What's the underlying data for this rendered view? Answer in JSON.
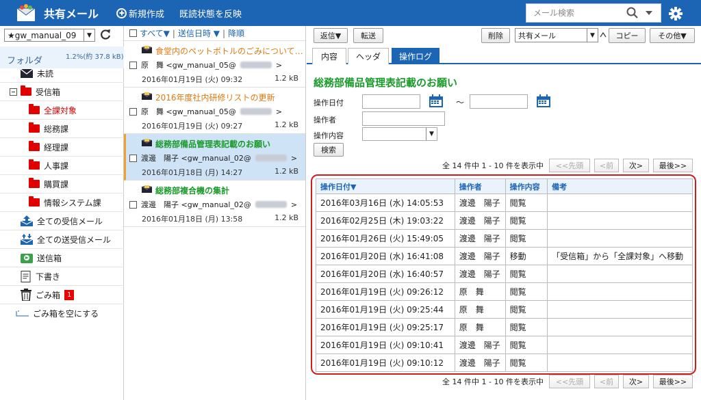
{
  "header": {
    "app_title": "共有メール",
    "new_label": "新規作成",
    "reflect_label": "既読状態を反映",
    "search_placeholder": "メール検索"
  },
  "left": {
    "account": "★gw_manual_09",
    "folder_title": "フォルダ",
    "quota": "1.2%(約 37.8 kB)",
    "folders": [
      {
        "label": "未読",
        "icon": "envelope-icon"
      },
      {
        "label": "受信箱",
        "icon": "folder-icon"
      },
      {
        "label": "全課対象",
        "icon": "folder-icon"
      },
      {
        "label": "総務課",
        "icon": "folder-icon"
      },
      {
        "label": "経理課",
        "icon": "folder-icon"
      },
      {
        "label": "人事課",
        "icon": "folder-icon"
      },
      {
        "label": "購買課",
        "icon": "folder-icon"
      },
      {
        "label": "情報システム課",
        "icon": "folder-icon"
      },
      {
        "label": "全ての受信メール",
        "icon": "inbox-all-icon"
      },
      {
        "label": "全ての送受信メール",
        "icon": "inbox-all-icon"
      },
      {
        "label": "送信箱",
        "icon": "outbox-icon"
      },
      {
        "label": "下書き",
        "icon": "draft-icon"
      },
      {
        "label": "ごみ箱",
        "icon": "trash-icon",
        "badge": "1"
      },
      {
        "label": "ごみ箱を空にする",
        "icon": "empty-trash-icon"
      }
    ]
  },
  "list": {
    "all_label": "すべて▼",
    "sort_label": "送信日時 ▼",
    "order_label": "降順",
    "messages": [
      {
        "subject": "食堂内のペットボトルのごみについて…",
        "from": "原　舞 <gw_manual_05@",
        "date": "2016年01月19日 (火) 09:32",
        "size": "1.2 kB"
      },
      {
        "subject": "2016年度社内研修リストの更新",
        "from": "原　舞 <gw_manual_05@",
        "date": "2016年01月19日 (火) 09:27",
        "size": "1.2 kB"
      },
      {
        "subject": "総務部備品管理表記載のお願い",
        "from": "渡邊　陽子 <gw_manual_02@",
        "date": "2016年01月18日 (月) 14:27",
        "size": "1.2 kB"
      },
      {
        "subject": "総務部複合機の集計",
        "from": "渡邊　陽子 <gw_manual_02@",
        "date": "2016年01月18日 (月) 13:58",
        "size": "1.2 kB"
      }
    ]
  },
  "toolbar": {
    "reply": "返信▼",
    "forward": "転送",
    "delete": "削除",
    "folder_value": "共有メール",
    "copy": "コピー",
    "more": "その他▼"
  },
  "tabs": [
    "内容",
    "ヘッダ",
    "操作ログ"
  ],
  "form": {
    "title": "総務部備品管理表記載のお願い",
    "date_label": "操作日付",
    "tilde": "～",
    "operator_label": "操作者",
    "action_label": "操作内容",
    "search_btn": "検索"
  },
  "pager": {
    "summary": "全 14 件中 1 - 10 件を表示中",
    "first": "<<先頭",
    "prev": "<前",
    "next": "次>",
    "last": "最後>>"
  },
  "log": {
    "headers": [
      "操作日付▼",
      "操作者",
      "操作内容",
      "備考"
    ],
    "rows": [
      [
        "2016年03月16日 (水) 14:05:53",
        "渡邊　陽子",
        "閲覧",
        ""
      ],
      [
        "2016年02月25日 (木) 19:03:22",
        "渡邊　陽子",
        "閲覧",
        ""
      ],
      [
        "2016年01月26日 (火) 15:49:05",
        "渡邊　陽子",
        "閲覧",
        ""
      ],
      [
        "2016年01月20日 (水) 16:41:08",
        "渡邊　陽子",
        "移動",
        "「受信箱」から「全課対象」へ移動"
      ],
      [
        "2016年01月20日 (水) 16:40:57",
        "渡邊　陽子",
        "閲覧",
        ""
      ],
      [
        "2016年01月19日 (火) 09:26:12",
        "原　舞",
        "閲覧",
        ""
      ],
      [
        "2016年01月19日 (火) 09:25:44",
        "原　舞",
        "閲覧",
        ""
      ],
      [
        "2016年01月19日 (火) 09:25:17",
        "原　舞",
        "閲覧",
        ""
      ],
      [
        "2016年01月19日 (火) 09:10:41",
        "渡邊　陽子",
        "閲覧",
        ""
      ],
      [
        "2016年01月19日 (火) 09:10:12",
        "渡邊　陽子",
        "閲覧",
        ""
      ]
    ]
  }
}
